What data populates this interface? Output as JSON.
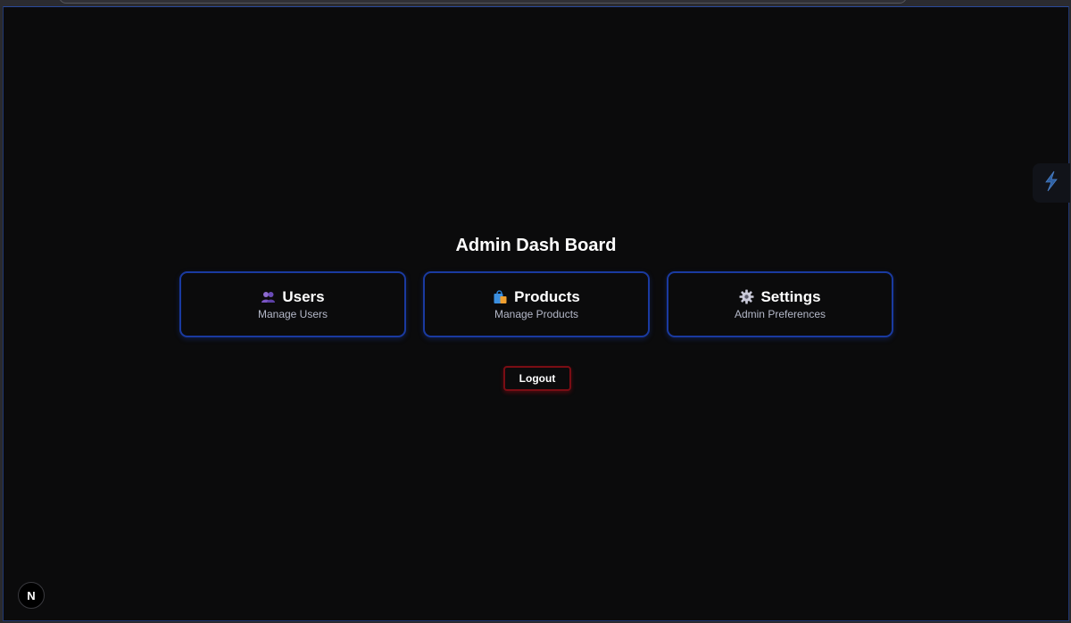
{
  "dashboard": {
    "title": "Admin Dash Board",
    "cards": [
      {
        "label": "Users",
        "description": "Manage Users",
        "icon": "users-icon"
      },
      {
        "label": "Products",
        "description": "Manage Products",
        "icon": "shopping-bag-icon"
      },
      {
        "label": "Settings",
        "description": "Admin Preferences",
        "icon": "gear-icon"
      }
    ],
    "logout_label": "Logout"
  },
  "overlay": {
    "next_badge_label": "N",
    "side_tab_icon": "lightning-icon"
  },
  "colors": {
    "background": "#0b0b0c",
    "card_border": "#1a3aa0",
    "logout_border": "#7a0d14",
    "text": "#ffffff",
    "subtext": "#b4b8c8"
  }
}
